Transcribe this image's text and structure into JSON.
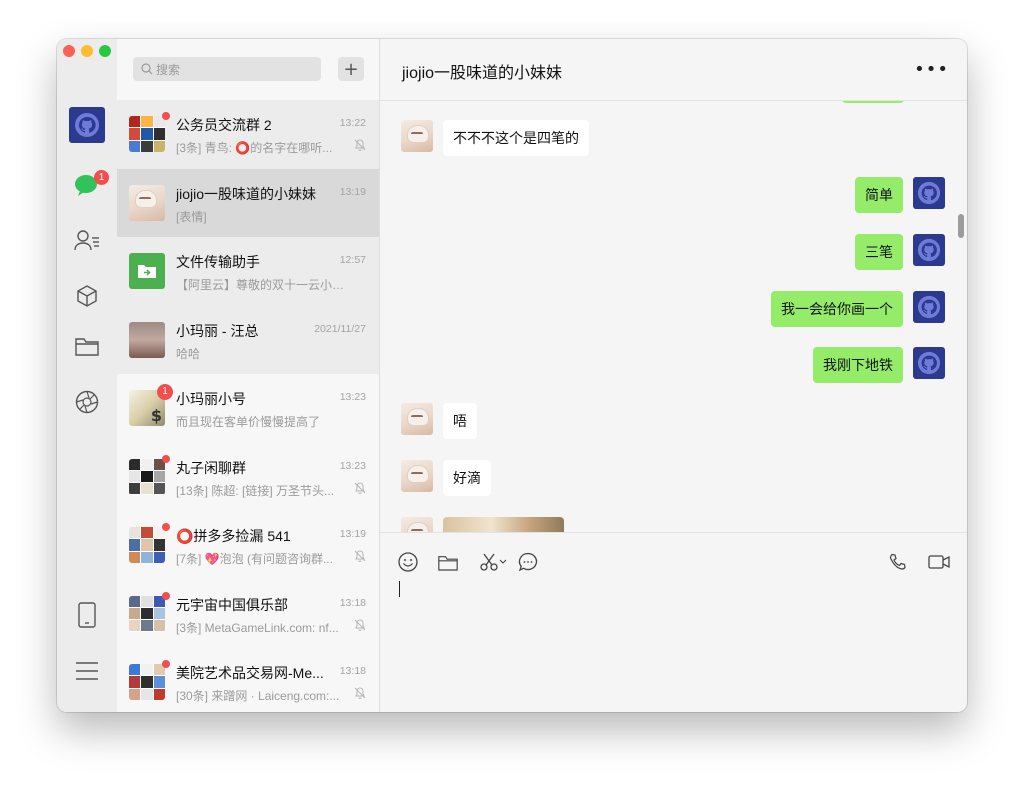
{
  "app": {
    "search_placeholder": "搜索",
    "add_label": "+",
    "chat_badge": "1"
  },
  "conversations": [
    {
      "title": "公务员交流群 2",
      "time": "13:22",
      "preview": "[3条] 青鸟: ⭕的名字在哪听...",
      "muted": true,
      "badge": "dot",
      "state": "pinned"
    },
    {
      "title": "jiojio一股味道的小妹妹",
      "time": "13:19",
      "preview": "[表情]",
      "muted": false,
      "badge": "",
      "state": "active"
    },
    {
      "title": "文件传输助手",
      "time": "12:57",
      "preview": "【阿里云】尊敬的双十一云小宝...",
      "muted": false,
      "badge": "",
      "state": "pinned"
    },
    {
      "title": "小玛丽 - 汪总",
      "time": "2021/11/27",
      "preview": "哈哈",
      "muted": false,
      "badge": "",
      "state": "pinned"
    },
    {
      "title": "小玛丽小号",
      "time": "13:23",
      "preview": "而且现在客单价慢慢提高了",
      "muted": false,
      "badge": "1",
      "state": "normal"
    },
    {
      "title": "丸子闲聊群",
      "time": "13:23",
      "preview": "[13条] 陈超: [链接] 万圣节头...",
      "muted": true,
      "badge": "dot",
      "state": "normal"
    },
    {
      "title": "⭕拼多多捡漏 541",
      "time": "13:19",
      "preview": "[7条] 💖泡泡 (有问题咨询群...",
      "muted": true,
      "badge": "dot",
      "state": "normal"
    },
    {
      "title": "元宇宙中国俱乐部",
      "time": "13:18",
      "preview": "[3条] MetaGameLink.com: nf...",
      "muted": true,
      "badge": "dot",
      "state": "normal"
    },
    {
      "title": "美院艺术品交易网-Me...",
      "time": "13:18",
      "preview": "[30条] 来蹭网 · Laiceng.com:...",
      "muted": true,
      "badge": "dot",
      "state": "normal"
    }
  ],
  "chat": {
    "title": "jiojio一股味道的小妹妹",
    "more_label": "•••",
    "messages": [
      {
        "side": "in",
        "text": "不不不这个是四笔的"
      },
      {
        "side": "out",
        "text": "简单"
      },
      {
        "side": "out",
        "text": "三笔"
      },
      {
        "side": "out",
        "text": "我一会给你画一个"
      },
      {
        "side": "out",
        "text": "我刚下地铁"
      },
      {
        "side": "in",
        "text": "唔"
      },
      {
        "side": "in",
        "text": "好滴"
      }
    ]
  },
  "colors": {
    "outgoing_bubble": "#95ec69",
    "incoming_bubble": "#ffffff",
    "badge_red": "#f24e4e",
    "file_helper_green": "#4caf50",
    "github_avatar_blue": "#2b3a8f"
  },
  "icons": [
    "github-icon",
    "chat-icon",
    "contacts-icon",
    "cube-icon",
    "folder-icon",
    "aperture-icon",
    "phone-device-icon",
    "menu-icon",
    "emoji-icon",
    "scissors-icon",
    "bubble-icon",
    "call-icon",
    "video-icon",
    "mute-bell-icon"
  ]
}
